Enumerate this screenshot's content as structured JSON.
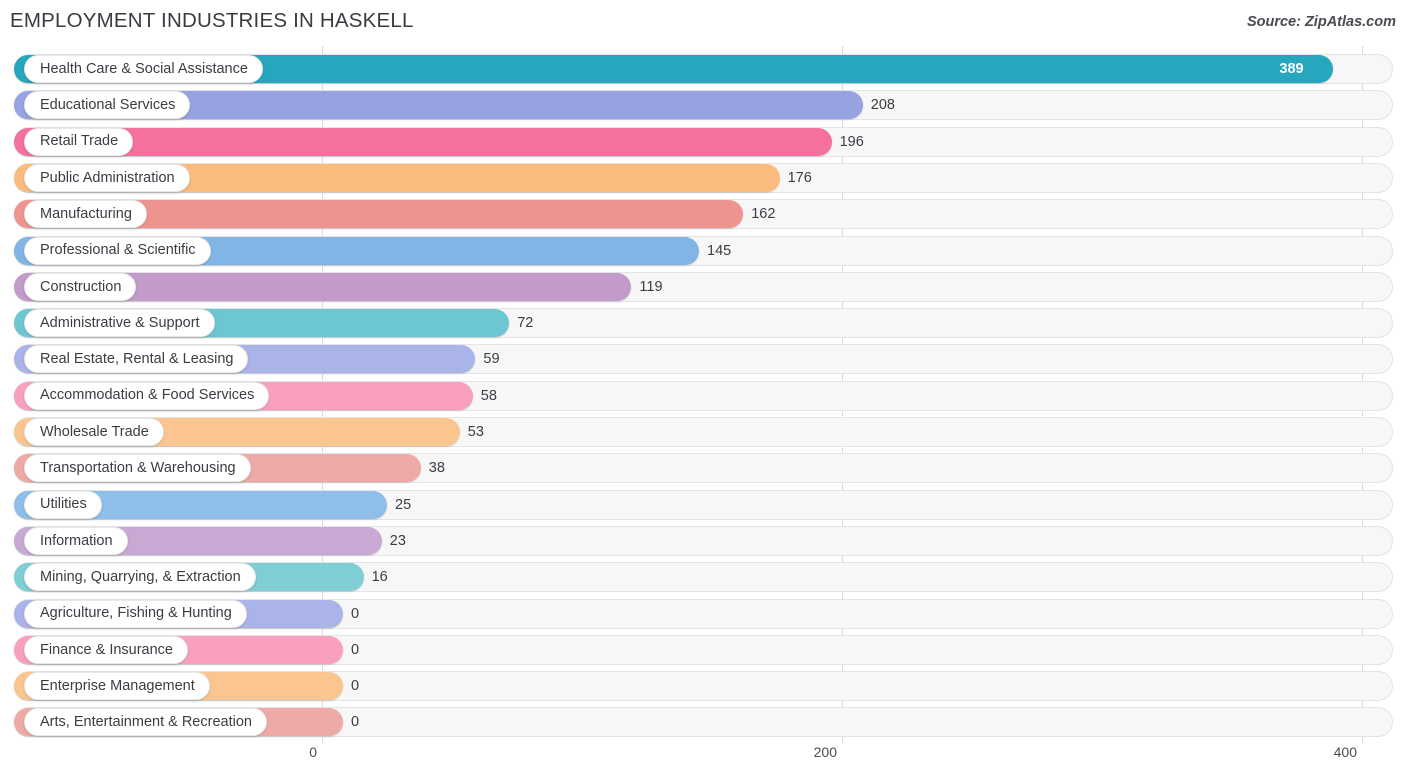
{
  "header": {
    "title": "EMPLOYMENT INDUSTRIES IN HASKELL",
    "source": "Source: ZipAtlas.com"
  },
  "chart_data": {
    "type": "bar",
    "orientation": "horizontal",
    "title": "EMPLOYMENT INDUSTRIES IN HASKELL",
    "xlabel": "",
    "ylabel": "",
    "xlim": [
      0,
      400
    ],
    "xticks": [
      0,
      200,
      400
    ],
    "xtick_labels": [
      "0",
      "200",
      "400"
    ],
    "grid": true,
    "legend": "none",
    "categories": [
      "Health Care & Social Assistance",
      "Educational Services",
      "Retail Trade",
      "Public Administration",
      "Manufacturing",
      "Professional & Scientific",
      "Construction",
      "Administrative & Support",
      "Real Estate, Rental & Leasing",
      "Accommodation & Food Services",
      "Wholesale Trade",
      "Transportation & Warehousing",
      "Utilities",
      "Information",
      "Mining, Quarrying, & Extraction",
      "Agriculture, Fishing & Hunting",
      "Finance & Insurance",
      "Enterprise Management",
      "Arts, Entertainment & Recreation"
    ],
    "values": [
      389,
      208,
      196,
      176,
      162,
      145,
      119,
      72,
      59,
      58,
      53,
      38,
      25,
      23,
      16,
      0,
      0,
      0,
      0
    ],
    "value_labels": [
      "389",
      "208",
      "196",
      "176",
      "162",
      "145",
      "119",
      "72",
      "59",
      "58",
      "53",
      "38",
      "25",
      "23",
      "16",
      "0",
      "0",
      "0",
      "0"
    ],
    "colors": [
      "#26a7bd",
      "#97a2e0",
      "#f4709f",
      "#fabb7c",
      "#ee948f",
      "#80b5e5",
      "#c29bcb",
      "#6cc7d2",
      "#aab4e8",
      "#f9a0c1",
      "#fbc58f",
      "#eeaaa6",
      "#8fbfe9",
      "#c8a9d3",
      "#7fcdd5",
      "#aab4e8",
      "#f9a0c1",
      "#fbc58f",
      "#eeaaa6"
    ]
  }
}
